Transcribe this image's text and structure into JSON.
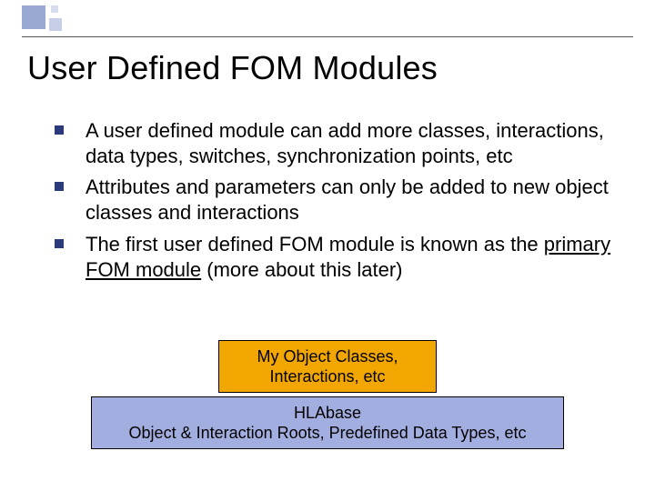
{
  "title": "User Defined FOM Modules",
  "bullets": [
    {
      "text": "A user defined module can add more classes, interactions, data types, switches, synchronization points, etc"
    },
    {
      "text": "Attributes and parameters can only be added to new object classes and interactions"
    },
    {
      "pre": "The first user defined FOM module is known as the ",
      "underlined": "primary FOM module",
      "post": " (more about this later)"
    }
  ],
  "box_top_line1": "My Object Classes,",
  "box_top_line2": "Interactions, etc",
  "box_bottom_line1": "HLAbase",
  "box_bottom_line2": "Object & Interaction Roots, Predefined Data Types, etc"
}
